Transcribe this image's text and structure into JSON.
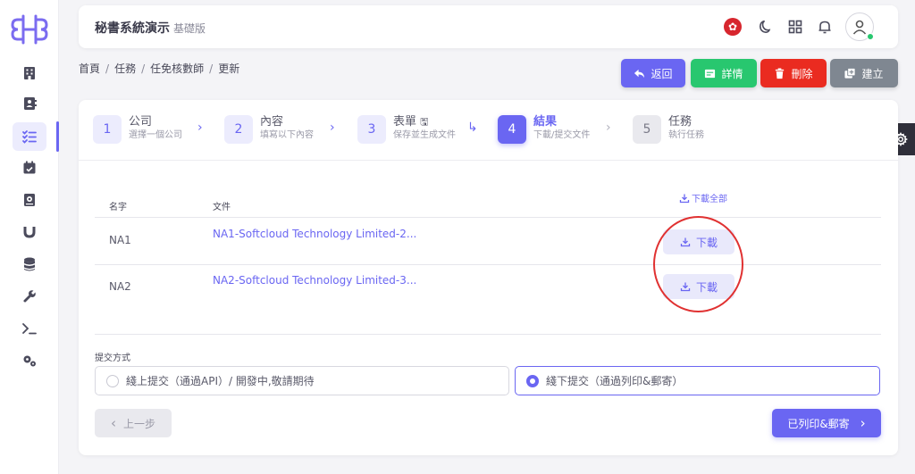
{
  "app": {
    "title": "秘書系統演示",
    "edition": "基礎版"
  },
  "breadcrumb": [
    "首頁",
    "任務",
    "任免核數師",
    "更新"
  ],
  "actions": [
    {
      "label": "返回",
      "color": "#6a66f2"
    },
    {
      "label": "詳情",
      "color": "#28c76f"
    },
    {
      "label": "刪除",
      "color": "#ea2b20"
    },
    {
      "label": "建立",
      "color": "#7f8791"
    }
  ],
  "steps": [
    {
      "num": "1",
      "title": "公司",
      "sub": "選擇一個公司"
    },
    {
      "num": "2",
      "title": "內容",
      "sub": "填寫以下內容"
    },
    {
      "num": "3",
      "title": "表單",
      "sub": "保存並生成文件"
    },
    {
      "num": "4",
      "title": "結果",
      "sub": "下載/提交文件"
    },
    {
      "num": "5",
      "title": "任務",
      "sub": "執行任務"
    }
  ],
  "table": {
    "col_name": "名字",
    "col_file": "文件",
    "download_all": "下載全部",
    "rows": [
      {
        "name": "NA1",
        "file": "NA1-Softcloud Technology Limited-2...",
        "action": "下載"
      },
      {
        "name": "NA2",
        "file": "NA2-Softcloud Technology Limited-3...",
        "action": "下載"
      }
    ]
  },
  "submit": {
    "label": "提交方式",
    "options": [
      {
        "label": "綫上提交（通過API）/ 開發中,敬請期待",
        "selected": false
      },
      {
        "label": "綫下提交（通過列印&郵寄）",
        "selected": true
      }
    ]
  },
  "nav": {
    "prev": "上一步",
    "next": "已列印&郵寄"
  },
  "colors": {
    "primary": "#6a66f2",
    "highlight": "#e03131"
  }
}
